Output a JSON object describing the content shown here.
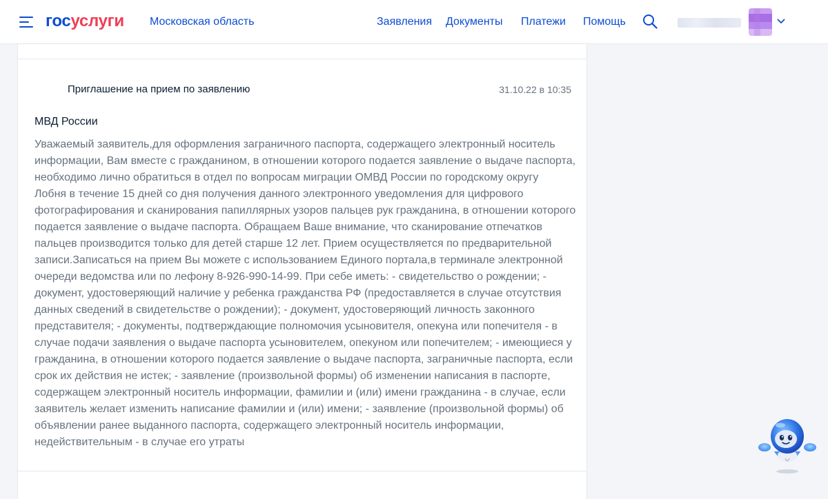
{
  "header": {
    "logo_part1": "гос",
    "logo_part2": "услуги",
    "region": "Московская область",
    "nav": [
      "Заявления",
      "Документы",
      "Платежи",
      "Помощь"
    ],
    "icons": {
      "menu": "burger-menu-icon",
      "search": "search-icon",
      "user_menu": "chevron-down-icon"
    }
  },
  "message": {
    "title": "Приглашение на прием по заявлению",
    "date": "31.10.22 в 10:35",
    "sender": "МВД России",
    "body_lines": [
      "Уважаемый заявитель,для оформления заграничного паспорта, содержащего электронный носитель",
      "информации, Вам вместе с гражданином, в отношении которого подается заявление о выдаче паспорта,",
      "необходимо лично обратиться в отдел по вопросам миграции ОМВД России по городскому округу",
      "Лобня в течение 15 дней со дня получения данного электронного уведомления для цифрового",
      "фотографирования и сканирования папиллярных узоров пальцев рук гражданина, в отношении которого",
      "подается заявление о выдаче паспорта. Обращаем Ваше внимание, что сканирование отпечатков",
      "пальцев производится только для детей старше 12 лет. Прием осуществляется по предварительной",
      "записи.Записаться на прием Вы можете с использованием Единого портала,в терминале электронной",
      "очереди ведомства или по лефону 8-926-990-14-99. При себе иметь: - свидетельство о рождении; -",
      "документ, удостоверяющий наличие у ребенка гражданства РФ (предоставляется в случае отсутствия",
      "данных сведений в свидетельстве о рождении); - документ, удостоверяющий личность законного",
      "представителя; - документы, подтверждающие полномочия усыновителя, опекуна или попечителя - в",
      "случае подачи заявления о выдаче паспорта усыновителем, опекуном или попечителем; - имеющиеся у",
      "гражданина, в отношении которого подается заявление о выдаче паспорта, заграничные паспорта, если",
      "срок их действия не истек; - заявление (произвольной формы) об изменении написания в паспорте,",
      "содержащем электронный носитель информации, фамилии и (или) имени гражданина - в случае, если",
      "заявитель желает изменить написание фамилии и (или) имени; - заявление (произвольной формы) об",
      "объявлении ранее выданного паспорта, содержащего электронный носитель информации,",
      "недействительным - в случае его утраты"
    ]
  },
  "assistant": {
    "icon": "robot-assistant-icon"
  },
  "colors": {
    "brand_blue": "#0d4cd3",
    "brand_red": "#ee3f58",
    "text_primary": "#0b1f33",
    "text_secondary": "#66727f",
    "page_bg": "#f3f5f8"
  }
}
